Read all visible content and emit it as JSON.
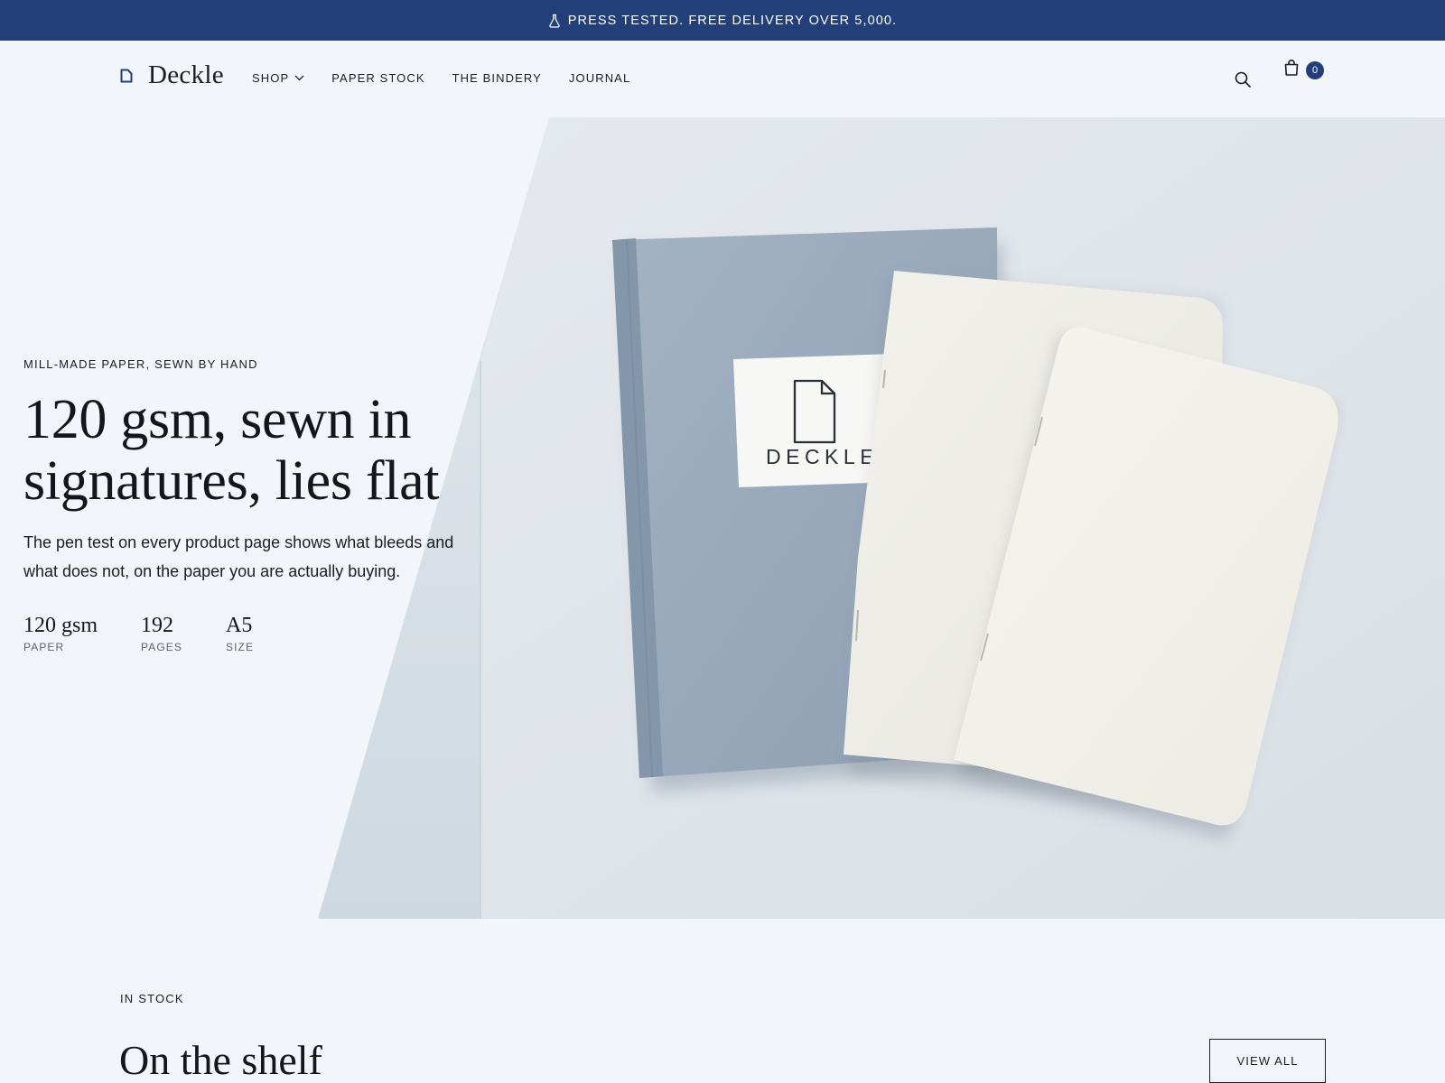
{
  "announcement": {
    "text": "PRESS TESTED. FREE DELIVERY OVER 5,000.",
    "icon": "flask-icon"
  },
  "header": {
    "logo_text": "Deckle",
    "logo_icon": "page-icon",
    "nav": [
      {
        "label": "SHOP",
        "has_dropdown": true
      },
      {
        "label": "PAPER STOCK"
      },
      {
        "label": "THE BINDERY"
      },
      {
        "label": "JOURNAL"
      }
    ],
    "search_icon": "search-icon",
    "cart_icon": "shopping-bag-icon",
    "cart_count": "0"
  },
  "hero": {
    "eyebrow": "MILL-MADE PAPER, SEWN BY HAND",
    "headline": "120 gsm, sewn in signatures, lies flat",
    "lede": "The pen test on every product page shows what bleeds and what does not, on the paper you are actually buying.",
    "specs": [
      {
        "value": "120 gsm",
        "label": "PAPER"
      },
      {
        "value": "192",
        "label": "PAGES"
      },
      {
        "value": "A5",
        "label": "SIZE"
      }
    ],
    "image_label": "DECKLE"
  },
  "shelf": {
    "eyebrow": "IN STOCK",
    "title": "On the shelf",
    "view_all_label": "VIEW ALL"
  },
  "colors": {
    "accent": "#223f7a",
    "background": "#f2f6fa",
    "text": "#1a1d24",
    "notebook_cover": "#9aabbd",
    "notebook_paper": "#f4f3ee"
  }
}
